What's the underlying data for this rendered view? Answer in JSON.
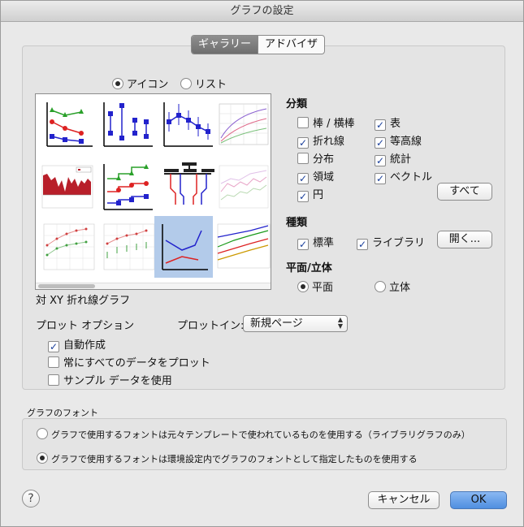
{
  "window": {
    "title": "グラフの設定"
  },
  "tabs": [
    {
      "label": "ギャラリー",
      "active": true
    },
    {
      "label": "アドバイザ",
      "active": false
    }
  ],
  "view_mode": {
    "options": [
      {
        "label": "アイコン",
        "selected": true
      },
      {
        "label": "リスト",
        "selected": false
      }
    ]
  },
  "gallery": {
    "selected_index": 10,
    "selected_name": "対 XY 折れ線グラフ"
  },
  "category": {
    "heading": "分類",
    "items": [
      {
        "label": "棒 / 横棒",
        "checked": false
      },
      {
        "label": "表",
        "checked": true
      },
      {
        "label": "折れ線",
        "checked": true
      },
      {
        "label": "等高線",
        "checked": true
      },
      {
        "label": "分布",
        "checked": false
      },
      {
        "label": "統計",
        "checked": true
      },
      {
        "label": "領域",
        "checked": true
      },
      {
        "label": "ベクトル",
        "checked": true
      },
      {
        "label": "円",
        "checked": true
      }
    ],
    "all_button": "すべて"
  },
  "kind": {
    "heading": "種類",
    "items": [
      {
        "label": "標準",
        "checked": true
      },
      {
        "label": "ライブラリ",
        "checked": true
      }
    ],
    "open_button": "開く..."
  },
  "dimension": {
    "heading": "平面/立体",
    "options": [
      {
        "label": "平面",
        "selected": true
      },
      {
        "label": "立体",
        "selected": false
      }
    ]
  },
  "plot_options": {
    "heading": "プロット オプション",
    "plot_in_label": "プロットイン:",
    "plot_in_value": "新規ページ",
    "checks": [
      {
        "label": "自動作成",
        "checked": true
      },
      {
        "label": "常にすべてのデータをプロット",
        "checked": false
      },
      {
        "label": "サンプル データを使用",
        "checked": false
      }
    ]
  },
  "graph_font": {
    "heading": "グラフのフォント",
    "options": [
      {
        "label": "グラフで使用するフォントは元々テンプレートで使われているものを使用する（ライブラリグラフのみ）",
        "selected": false
      },
      {
        "label": "グラフで使用するフォントは環境設定内でグラフのフォントとして指定したものを使用する",
        "selected": true
      }
    ]
  },
  "footer": {
    "help": "?",
    "cancel": "キャンセル",
    "ok": "OK"
  },
  "colors": {
    "accent": "#4f8fe0",
    "selected_thumb": "#b3cbea",
    "check": "#1a3f9b"
  }
}
